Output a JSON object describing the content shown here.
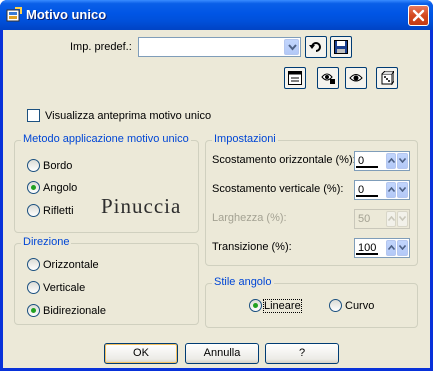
{
  "window": {
    "title": "Motivo unico"
  },
  "preset": {
    "label": "Imp. predef.:",
    "value": ""
  },
  "preview_checkbox": {
    "label": "Visualizza anteprima motivo unico",
    "checked": false
  },
  "method_group": {
    "title": "Metodo applicazione motivo unico",
    "options": [
      {
        "label": "Bordo",
        "selected": false
      },
      {
        "label": "Angolo",
        "selected": true
      },
      {
        "label": "Rifletti",
        "selected": false
      }
    ]
  },
  "direction_group": {
    "title": "Direzione",
    "options": [
      {
        "label": "Orizzontale",
        "selected": false
      },
      {
        "label": "Verticale",
        "selected": false
      },
      {
        "label": "Bidirezionale",
        "selected": true
      }
    ]
  },
  "settings_group": {
    "title": "Impostazioni",
    "fields": [
      {
        "label": "Scostamento orizzontale (%):",
        "value": "0",
        "enabled": true
      },
      {
        "label": "Scostamento verticale (%):",
        "value": "0",
        "enabled": true
      },
      {
        "label": "Larghezza (%):",
        "value": "50",
        "enabled": false
      },
      {
        "label": "Transizione (%):",
        "value": "100",
        "enabled": true
      }
    ]
  },
  "corner_group": {
    "title": "Stile angolo",
    "options": [
      {
        "label": "Lineare",
        "selected": true
      },
      {
        "label": "Curvo",
        "selected": false
      }
    ]
  },
  "watermark": "Pinuccia",
  "buttons": {
    "ok": "OK",
    "cancel": "Annulla",
    "help": "?"
  }
}
